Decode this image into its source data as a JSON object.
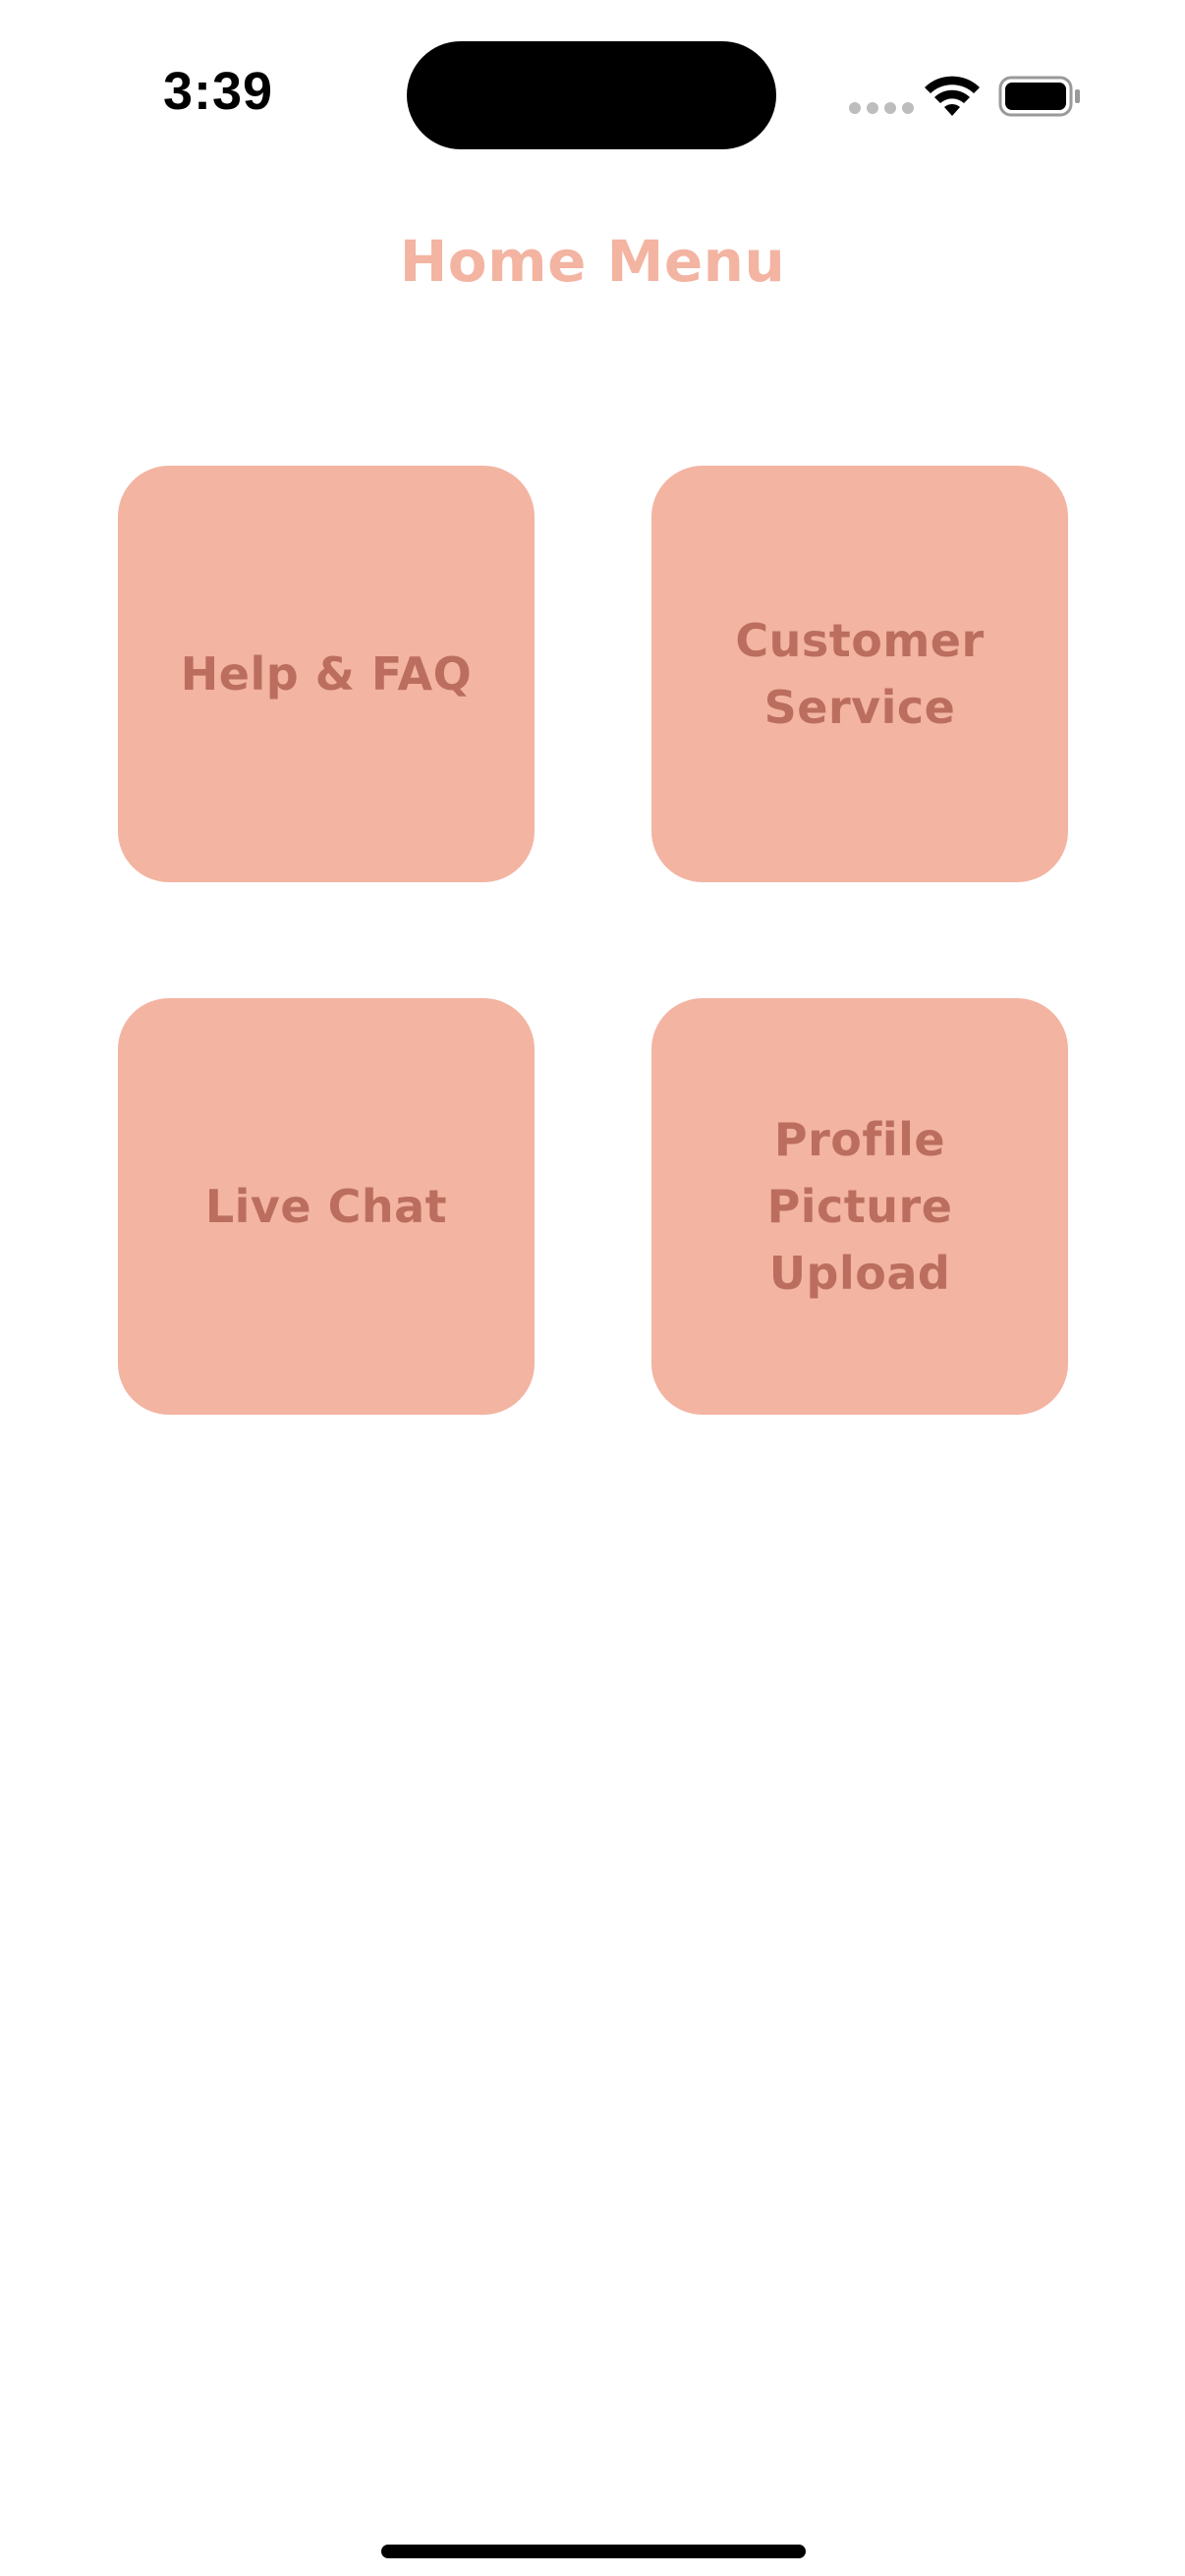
{
  "status_bar": {
    "time": "3:39",
    "icons": [
      "cellular-signal-icon",
      "wifi-icon",
      "battery-icon"
    ]
  },
  "header": {
    "title": "Home Menu"
  },
  "menu": {
    "items": [
      {
        "label": "Help & FAQ"
      },
      {
        "label": "Customer Service"
      },
      {
        "label": "Live Chat"
      },
      {
        "label": "Profile Picture Upload"
      }
    ]
  },
  "colors": {
    "title": "#f3b4a2",
    "tile_background": "#f3b4a2",
    "tile_text": "#bb6e5e",
    "background": "#ffffff"
  }
}
